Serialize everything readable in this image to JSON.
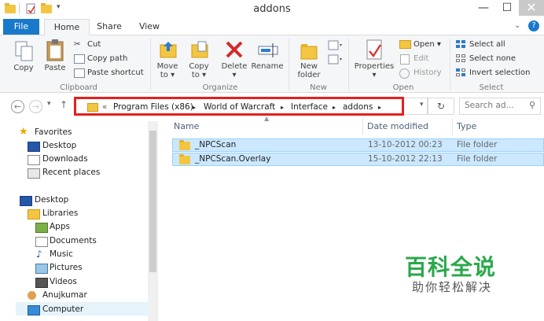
{
  "window": {
    "title": "addons"
  },
  "ribbon_tabs": [
    "File",
    "Home",
    "Share",
    "View"
  ],
  "clipboard": {
    "group_label": "Clipboard",
    "copy": "Copy",
    "paste": "Paste",
    "cut": "Cut",
    "copy_path": "Copy path",
    "paste_shortcut": "Paste shortcut"
  },
  "organize": {
    "group_label": "Organize",
    "move_to": "Move",
    "move_to_2": "to",
    "copy_to": "Copy",
    "copy_to_2": "to",
    "delete": "Delete",
    "rename": "Rename"
  },
  "new": {
    "group_label": "New",
    "new_folder": "New",
    "new_folder_2": "folder"
  },
  "open": {
    "group_label": "Open",
    "properties": "Properties",
    "open": "Open",
    "edit": "Edit",
    "history": "History"
  },
  "select": {
    "group_label": "Select",
    "select_all": "Select all",
    "select_none": "Select none",
    "invert": "Invert selection"
  },
  "address": {
    "overflow": "«",
    "crumbs": [
      "Program Files (x86)",
      "World of Warcraft",
      "Interface",
      "addons"
    ],
    "search_placeholder": "Search ad..."
  },
  "nav": {
    "favorites": "Favorites",
    "desktop_fav": "Desktop",
    "downloads": "Downloads",
    "recent": "Recent places",
    "desktop": "Desktop",
    "libraries": "Libraries",
    "apps": "Apps",
    "documents": "Documents",
    "music": "Music",
    "pictures": "Pictures",
    "videos": "Videos",
    "user": "Anujkumar",
    "computer": "Computer"
  },
  "columns": {
    "name": "Name",
    "date": "Date modified",
    "type": "Type"
  },
  "files": [
    {
      "name": "_NPCScan",
      "date": "13-10-2012 00:23",
      "type": "File folder"
    },
    {
      "name": "_NPCScan.Overlay",
      "date": "15-10-2012 22:13",
      "type": "File folder"
    }
  ],
  "watermark": {
    "title": "百科全说",
    "subtitle": "助你轻松解决"
  },
  "colors": {
    "accent": "#1979ca",
    "highlight": "#e51f1f",
    "selection": "#cce8ff",
    "watermark": "#29a84a"
  }
}
